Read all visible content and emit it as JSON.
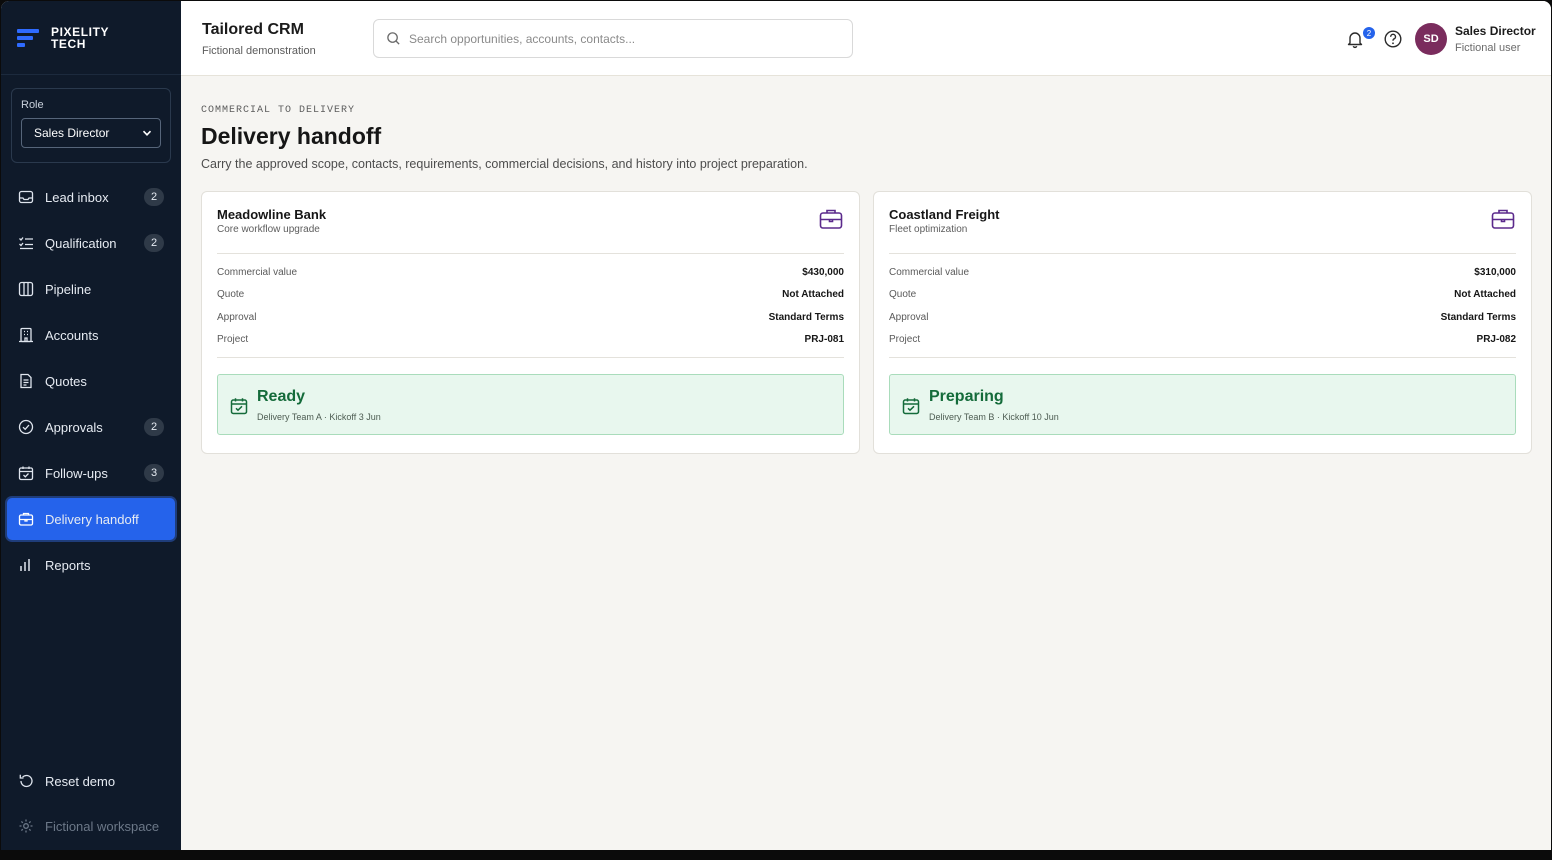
{
  "brand": {
    "line1": "PIXELITY",
    "line2": "TECH"
  },
  "role": {
    "label": "Role",
    "value": "Sales Director"
  },
  "nav": [
    {
      "label": "Lead inbox",
      "icon": "inbox-icon",
      "badge": "2"
    },
    {
      "label": "Qualification",
      "icon": "checklist-icon",
      "badge": "2"
    },
    {
      "label": "Pipeline",
      "icon": "columns-icon",
      "badge": ""
    },
    {
      "label": "Accounts",
      "icon": "building-icon",
      "badge": ""
    },
    {
      "label": "Quotes",
      "icon": "document-icon",
      "badge": ""
    },
    {
      "label": "Approvals",
      "icon": "check-circle-icon",
      "badge": "2"
    },
    {
      "label": "Follow-ups",
      "icon": "calendar-check-icon",
      "badge": "3"
    },
    {
      "label": "Delivery handoff",
      "icon": "briefcase-icon",
      "badge": "",
      "active": true
    },
    {
      "label": "Reports",
      "icon": "bar-chart-icon",
      "badge": ""
    }
  ],
  "sidebar_bottom": {
    "reset": "Reset demo",
    "workspace": "Fictional workspace"
  },
  "header": {
    "title": "Tailored CRM",
    "subtitle": "Fictional demonstration",
    "search_placeholder": "Search opportunities, accounts, contacts...",
    "notifications": "2",
    "user_initials": "SD",
    "user_name": "Sales Director",
    "user_sub": "Fictional user"
  },
  "page": {
    "eyebrow": "COMMERCIAL TO DELIVERY",
    "title": "Delivery handoff",
    "description": "Carry the approved scope, contacts, requirements, commercial decisions, and history into project preparation."
  },
  "labels": {
    "commercial_value": "Commercial value",
    "quote": "Quote",
    "approval": "Approval",
    "project": "Project"
  },
  "cards": [
    {
      "account": "Meadowline Bank",
      "opportunity": "Core workflow upgrade",
      "commercial_value": "$430,000",
      "quote": "Not Attached",
      "approval": "Standard Terms",
      "project": "PRJ-081",
      "status": "Ready",
      "status_detail": "Delivery Team A · Kickoff 3 Jun"
    },
    {
      "account": "Coastland Freight",
      "opportunity": "Fleet optimization",
      "commercial_value": "$310,000",
      "quote": "Not Attached",
      "approval": "Standard Terms",
      "project": "PRJ-082",
      "status": "Preparing",
      "status_detail": "Delivery Team B · Kickoff 10 Jun"
    }
  ],
  "colors": {
    "sidebar": "#0f1a2a",
    "accent": "#2563eb",
    "status_green": "#146b3a",
    "icon_purple": "#5b2a8c"
  }
}
